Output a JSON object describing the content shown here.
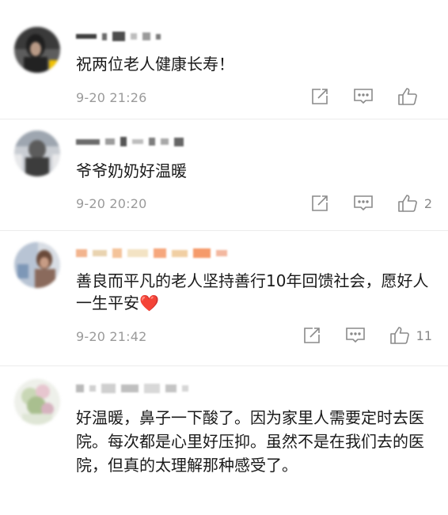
{
  "comments": [
    {
      "text": "祝两位老人健康长寿！",
      "time": "9-20 21:26",
      "like_count": ""
    },
    {
      "text": "爷爷奶奶好温暖",
      "time": "9-20 20:20",
      "like_count": "2"
    },
    {
      "text": "善良而平凡的老人坚持善行10年回馈社会，愿好人一生平安",
      "emoji": "❤️",
      "time": "9-20 21:42",
      "like_count": "11"
    },
    {
      "text": "好温暖，鼻子一下酸了。因为家里人需要定时去医院。每次都是心里好压抑。虽然不是在我们去的医院，但真的太理解那种感受了。"
    }
  ],
  "icons": {
    "share": "share-icon",
    "reply": "comment-icon",
    "like": "thumbs-up-icon"
  },
  "colors": {
    "text": "#1a1a1a",
    "meta": "#9a9a9a",
    "icon": "#8a8a8a",
    "heart": "#e0383e",
    "divider": "#ececec"
  }
}
